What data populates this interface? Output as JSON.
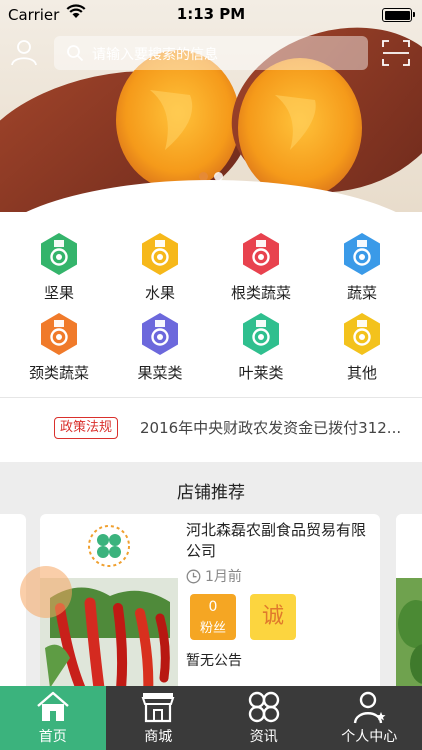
{
  "status": {
    "carrier": "Carrier",
    "time": "1:13 PM"
  },
  "search": {
    "placeholder": "请输入要搜索的信息"
  },
  "categories": [
    {
      "label": "坚果",
      "color": "#34b46b"
    },
    {
      "label": "水果",
      "color": "#f6b81a"
    },
    {
      "label": "根类蔬菜",
      "color": "#e8424e"
    },
    {
      "label": "蔬菜",
      "color": "#3a9ae8"
    },
    {
      "label": "颈类蔬菜",
      "color": "#f07a2a"
    },
    {
      "label": "果菜类",
      "color": "#6c68dc"
    },
    {
      "label": "叶莱类",
      "color": "#2fbf8e"
    },
    {
      "label": "其他",
      "color": "#f3c21c"
    }
  ],
  "news": {
    "tag": "政策法规",
    "text": "2016年中央财政农发资金已拨付312..."
  },
  "shops": {
    "title": "店铺推荐",
    "card": {
      "name": "河北森磊农副食品贸易有限公司",
      "time": "1月前",
      "fans_count": "0",
      "fans_label": "粉丝",
      "cheng": "诚",
      "notice": "暂无公告"
    }
  },
  "tabs": [
    {
      "label": "首页",
      "icon": "home-icon",
      "active": true
    },
    {
      "label": "商城",
      "icon": "store-icon",
      "active": false
    },
    {
      "label": "资讯",
      "icon": "news-icon",
      "active": false
    },
    {
      "label": "个人中心",
      "icon": "profile-icon",
      "active": false
    }
  ],
  "colors": {
    "accent": "#3bb37d",
    "tabbar": "#3a3a3a",
    "tag": "#d9302c",
    "fans": "#f5a623"
  }
}
